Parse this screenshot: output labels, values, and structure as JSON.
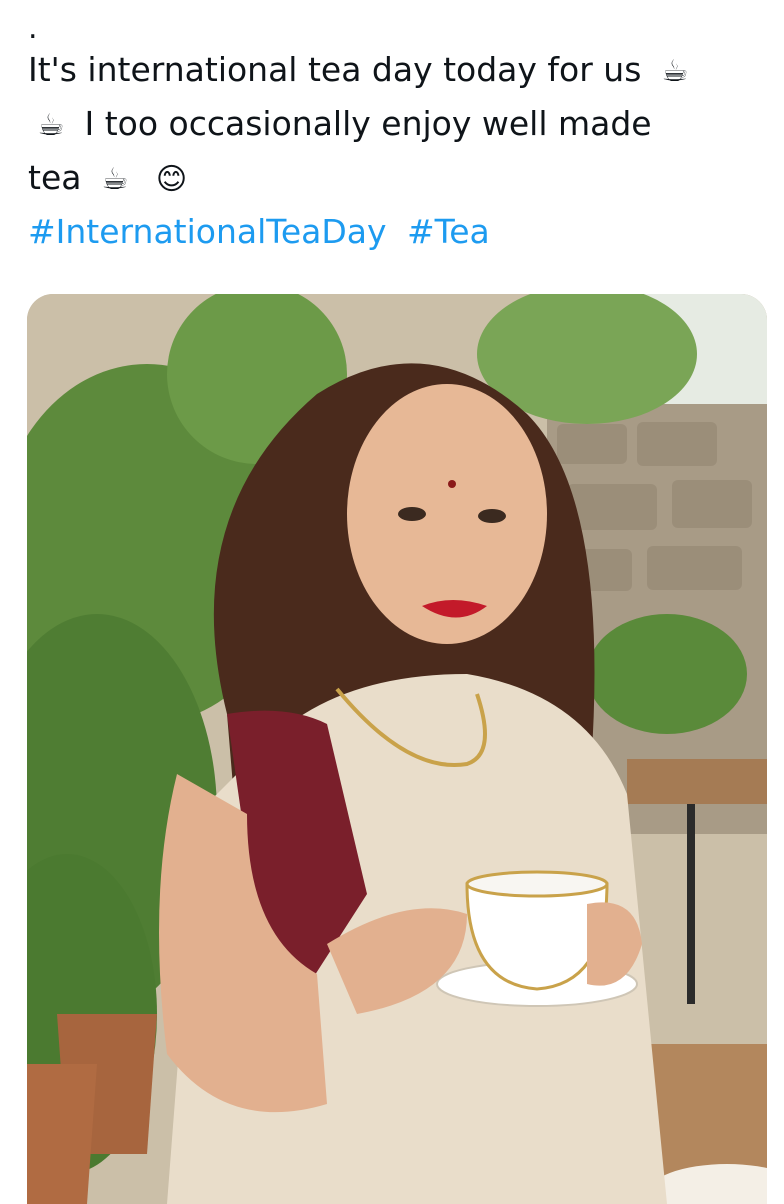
{
  "tweet": {
    "dot": ".",
    "line1": "It's international tea day today for us",
    "line2": "I too occasionally enjoy well made",
    "line3": "tea",
    "emoji_tea": "☕",
    "emoji_smile": "😊",
    "hashtags": [
      "#InternationalTeaDay",
      "#Tea"
    ]
  },
  "media": {
    "description_icon": "photo",
    "accent_hashtag_color": "#1d9bf0"
  }
}
